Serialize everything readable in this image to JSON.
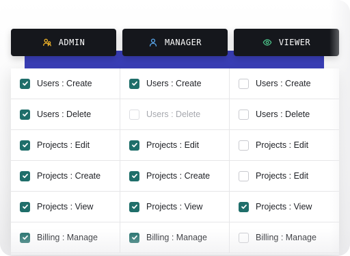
{
  "roles": [
    {
      "label": "ADMIN",
      "icon": "users-icon",
      "icon_color": "#f0b429"
    },
    {
      "label": "MANAGER",
      "icon": "user-icon",
      "icon_color": "#5aa9f0"
    },
    {
      "label": "VIEWER",
      "icon": "eye-icon",
      "icon_color": "#4cc38a"
    }
  ],
  "permissions": {
    "admin": [
      {
        "label": "Users : Create",
        "checked": true,
        "disabled": false
      },
      {
        "label": "Users : Delete",
        "checked": true,
        "disabled": false
      },
      {
        "label": "Projects : Edit",
        "checked": true,
        "disabled": false
      },
      {
        "label": "Projects : Create",
        "checked": true,
        "disabled": false
      },
      {
        "label": "Projects : View",
        "checked": true,
        "disabled": false
      },
      {
        "label": "Billing : Manage",
        "checked": true,
        "disabled": false
      }
    ],
    "manager": [
      {
        "label": "Users : Create",
        "checked": true,
        "disabled": false
      },
      {
        "label": "Users : Delete",
        "checked": false,
        "disabled": true
      },
      {
        "label": "Projects : Edit",
        "checked": true,
        "disabled": false
      },
      {
        "label": "Projects : Create",
        "checked": true,
        "disabled": false
      },
      {
        "label": "Projects : View",
        "checked": true,
        "disabled": false
      },
      {
        "label": "Billing : Manage",
        "checked": true,
        "disabled": false
      }
    ],
    "viewer": [
      {
        "label": "Users : Create",
        "checked": false,
        "disabled": false
      },
      {
        "label": "Users : Delete",
        "checked": false,
        "disabled": false
      },
      {
        "label": "Projects : Edit",
        "checked": false,
        "disabled": false
      },
      {
        "label": "Projects : Edit",
        "checked": false,
        "disabled": false
      },
      {
        "label": "Projects : View",
        "checked": true,
        "disabled": false
      },
      {
        "label": "Billing : Manage",
        "checked": false,
        "disabled": false
      }
    ]
  },
  "colors": {
    "checkbox_checked": "#1f6e6a",
    "header_bg": "#15171c",
    "accent_band": "#3a3fb8"
  }
}
